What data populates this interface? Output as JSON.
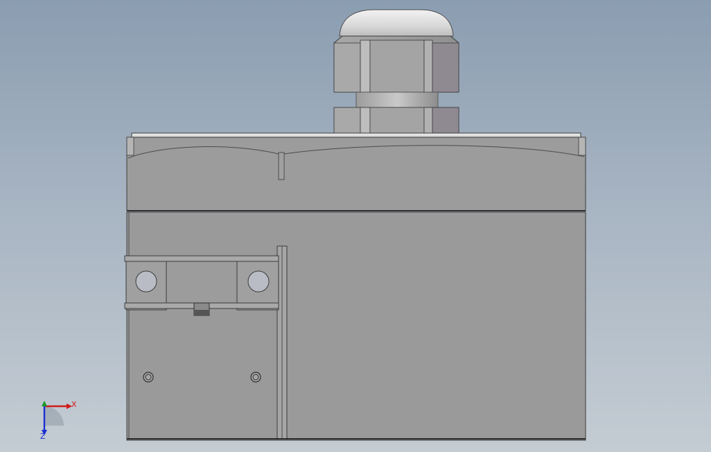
{
  "viewport": {
    "background_top": "#8b9db1",
    "background_bottom": "#c4ccd3"
  },
  "colors": {
    "body_gray": "#9a9a9a",
    "lid_gray": "#9c9c9c",
    "edge_dark": "#3a3a3a",
    "metal_light": "#d7d7d7",
    "hole_fill": "#b9bcc4",
    "axis_x": "#d11a1a",
    "axis_y": "#1b9a2a",
    "axis_z": "#1a2fd1"
  },
  "triad": {
    "x_label": "X",
    "z_label": "Z",
    "icons": [
      "axis-x-arrow-icon",
      "axis-y-arrow-icon",
      "axis-z-arrow-icon"
    ]
  }
}
